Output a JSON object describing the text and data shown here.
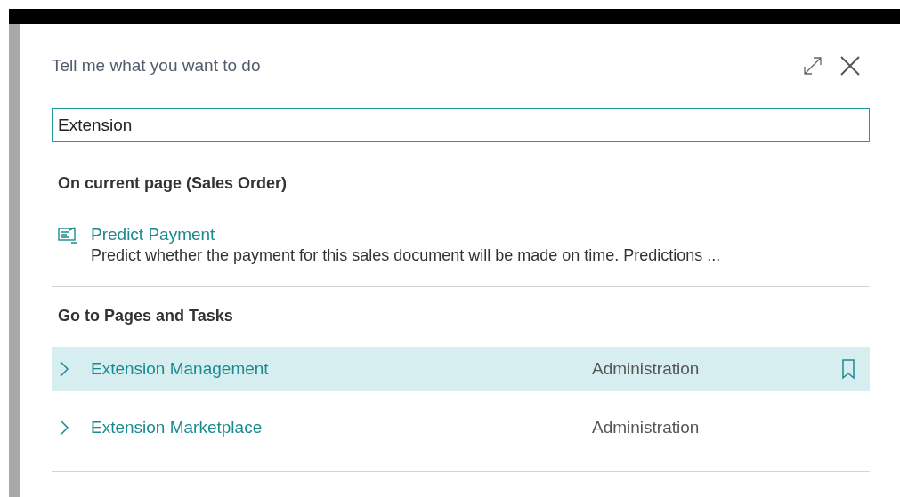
{
  "dialog": {
    "title": "Tell me what you want to do",
    "search": {
      "value": "Extension"
    }
  },
  "sections": [
    {
      "heading": "On current page (Sales Order)",
      "kind": "actions",
      "items": [
        {
          "title": "Predict Payment",
          "description": "Predict whether the payment for this sales document will be made on time. Predictions ..."
        }
      ]
    },
    {
      "heading": "Go to Pages and Tasks",
      "kind": "pages",
      "items": [
        {
          "title": "Extension Management",
          "category": "Administration",
          "selected": true
        },
        {
          "title": "Extension Marketplace",
          "category": "Administration",
          "selected": false
        }
      ]
    }
  ]
}
